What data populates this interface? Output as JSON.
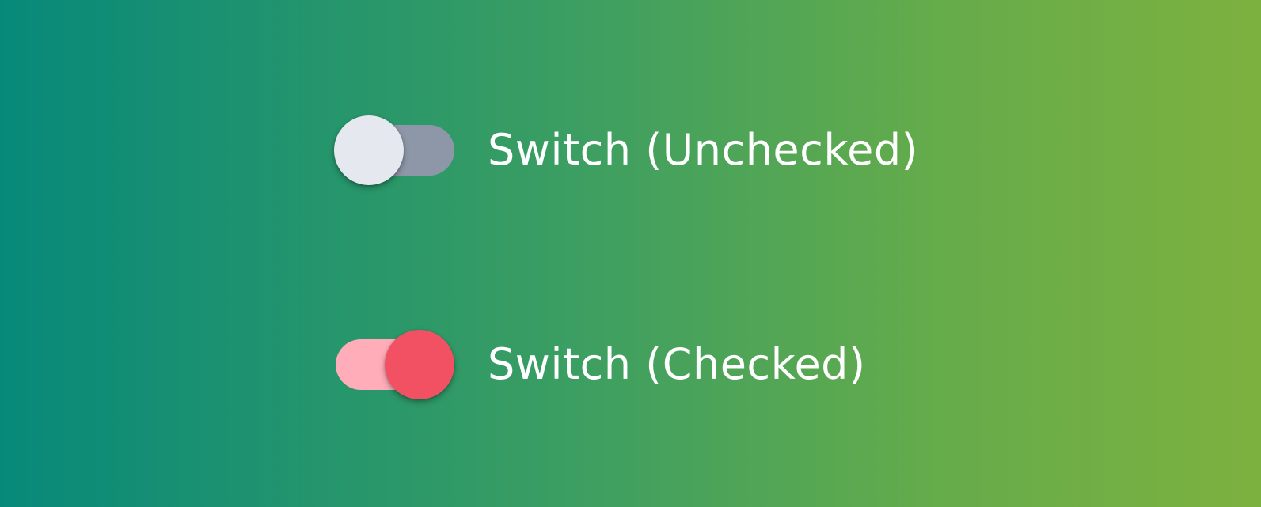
{
  "switches": [
    {
      "label": "Switch (Unchecked)",
      "checked": false,
      "track_color": "#8e97a8",
      "thumb_color": "#e6e8ef"
    },
    {
      "label": "Switch (Checked)",
      "checked": true,
      "track_color": "#ffadb9",
      "thumb_color": "#f15163"
    }
  ]
}
